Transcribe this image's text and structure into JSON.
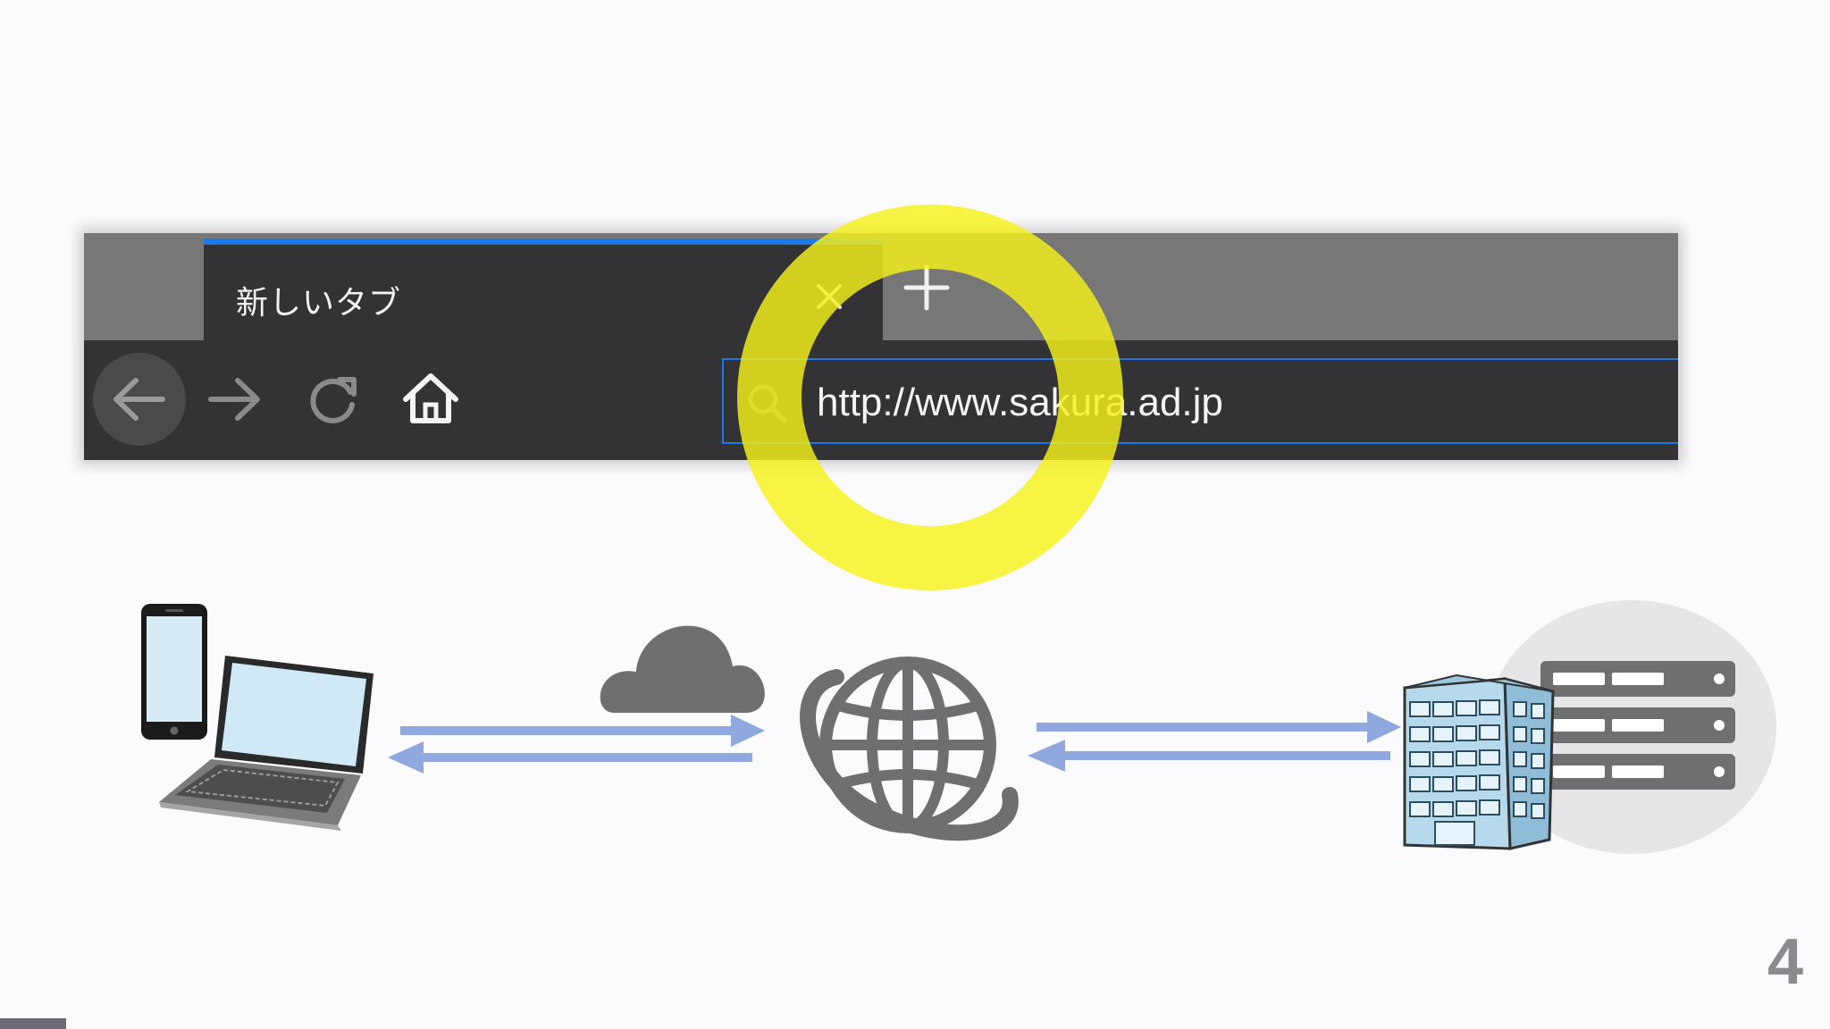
{
  "browser": {
    "tab_title": "新しいタブ",
    "url": "http://www.sakura.ad.jp",
    "accent_color": "#1c78e8",
    "buttons": {
      "back": "arrow-left-icon",
      "forward": "arrow-right-icon",
      "reload": "reload-icon",
      "home": "home-icon",
      "new_tab": "plus-icon",
      "close_tab": "close-icon",
      "search": "search-icon"
    }
  },
  "highlight": {
    "color": "#f5f21a"
  },
  "diagram": {
    "nodes": [
      "devices (smartphone + laptop)",
      "cloud",
      "internet globe",
      "office building + server"
    ],
    "arrow_color": "#8fa9de"
  },
  "footer": {
    "page_number": "4"
  }
}
